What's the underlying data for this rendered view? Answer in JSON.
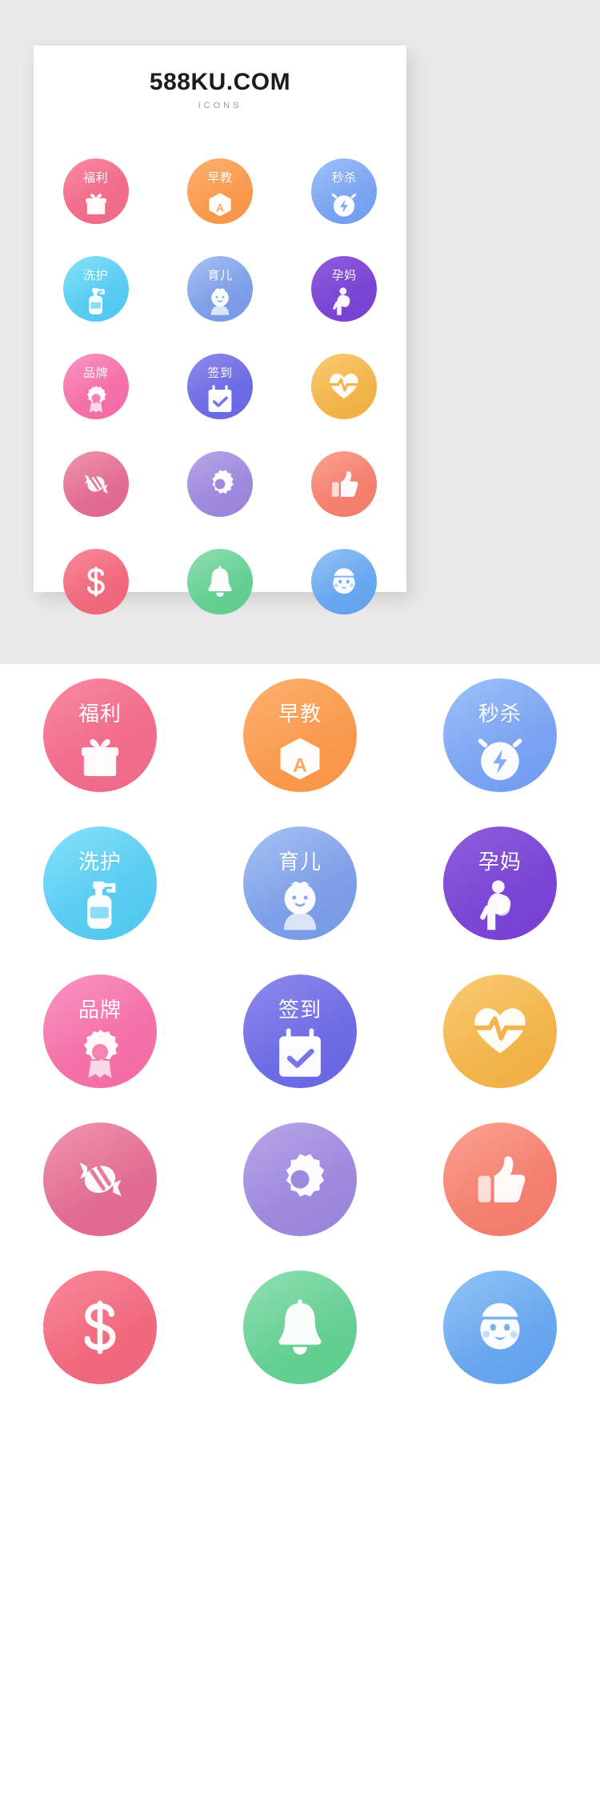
{
  "card": {
    "title": "588KU.COM",
    "subtitle": "ICONS"
  },
  "icons": [
    {
      "id": "fuli",
      "label": "福利",
      "glyph": "gift-icon",
      "color": "#ef6a87"
    },
    {
      "id": "zaojiao",
      "label": "早教",
      "glyph": "block-a-icon",
      "color": "#f79347"
    },
    {
      "id": "miaosha",
      "label": "秒杀",
      "glyph": "alarm-bolt-icon",
      "color": "#6f9cf0"
    },
    {
      "id": "xihu",
      "label": "洗护",
      "glyph": "lotion-icon",
      "color": "#4fc6ef"
    },
    {
      "id": "yuer",
      "label": "育儿",
      "glyph": "baby-icon",
      "color": "#7599e6"
    },
    {
      "id": "yunma",
      "label": "孕妈",
      "glyph": "pregnant-icon",
      "color": "#7640d2"
    },
    {
      "id": "pinpai",
      "label": "品牌",
      "glyph": "medal-icon",
      "color": "#f26ba4"
    },
    {
      "id": "qiandao",
      "label": "签到",
      "glyph": "calendar-check-icon",
      "color": "#6765e2"
    },
    {
      "id": "heart",
      "label": "",
      "glyph": "heartbeat-icon",
      "color": "#f1ad41"
    },
    {
      "id": "candy",
      "label": "",
      "glyph": "candy-icon",
      "color": "#df6590"
    },
    {
      "id": "gear",
      "label": "",
      "glyph": "gear-icon",
      "color": "#9883da"
    },
    {
      "id": "thumb",
      "label": "",
      "glyph": "thumbs-up-icon",
      "color": "#f27a6b"
    },
    {
      "id": "dollar",
      "label": "",
      "glyph": "dollar-icon",
      "color": "#ee657a"
    },
    {
      "id": "bell",
      "label": "",
      "glyph": "bell-icon",
      "color": "#5dcb8c"
    },
    {
      "id": "baby2",
      "label": "",
      "glyph": "baby-face-icon",
      "color": "#5fa0ed"
    }
  ]
}
